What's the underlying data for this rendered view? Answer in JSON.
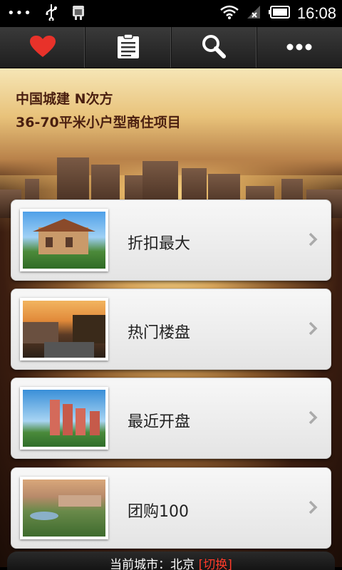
{
  "status_bar": {
    "time": "16:08",
    "left_icons": [
      "more-dots-icon",
      "usb-icon",
      "android-debug-icon"
    ],
    "right_icons": [
      "wifi-icon",
      "signal-icon",
      "battery-icon"
    ]
  },
  "toolbar": {
    "buttons": [
      {
        "icon": "heart-icon",
        "color": "#e8322a"
      },
      {
        "icon": "clipboard-icon",
        "color": "#ffffff"
      },
      {
        "icon": "search-icon",
        "color": "#ffffff"
      },
      {
        "icon": "more-icon",
        "color": "#ffffff"
      }
    ]
  },
  "banner": {
    "title": "中国城建 N次方",
    "subtitle": "36-70平米小户型商住项目"
  },
  "list": {
    "items": [
      {
        "label": "折扣最大",
        "image": "villa-photo"
      },
      {
        "label": "热门楼盘",
        "image": "street-sunset-photo"
      },
      {
        "label": "最近开盘",
        "image": "apartment-towers-photo"
      },
      {
        "label": "团购100",
        "image": "golf-resort-photo"
      }
    ]
  },
  "footer": {
    "prefix": "当前城市：北京",
    "switch_label": "[切换]"
  }
}
